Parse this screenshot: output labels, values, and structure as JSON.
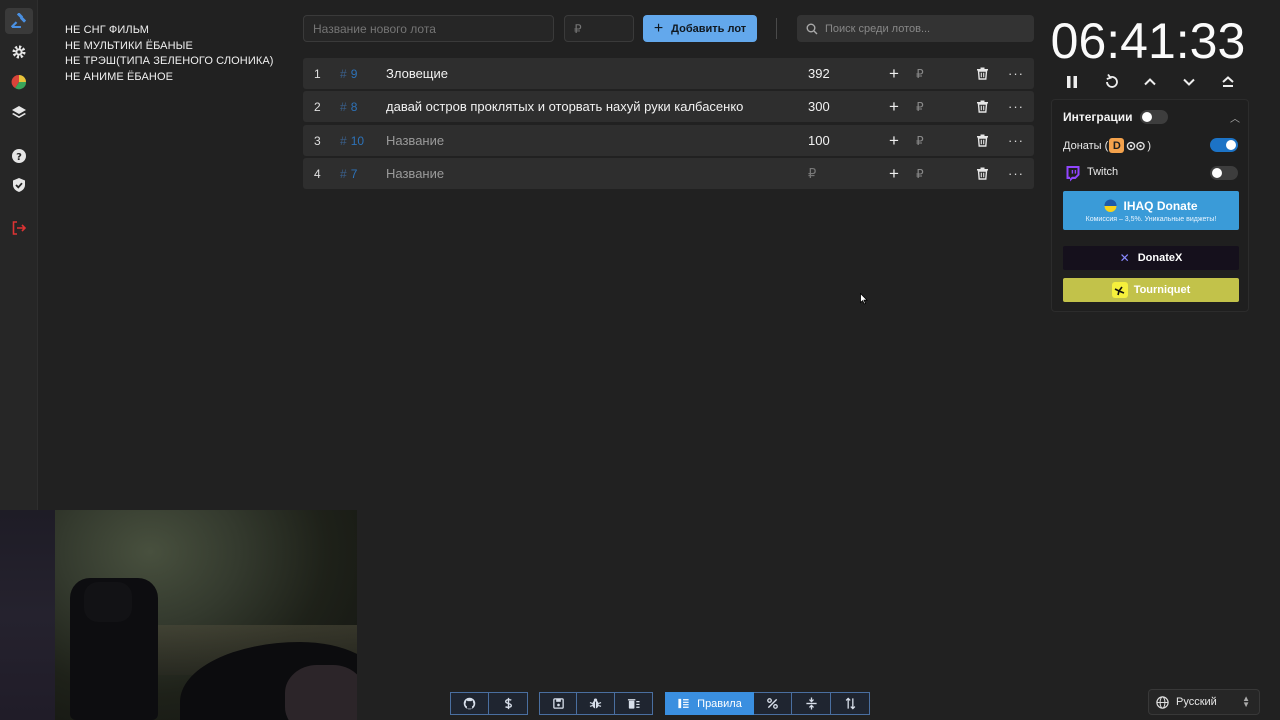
{
  "colors": {
    "accent": "#63a8ec",
    "background": "#212121",
    "row": "#2e2e2e",
    "lot_id": "#2d72b8",
    "ihaq": "#3a9bd8",
    "donatex": "#15101c",
    "tourniquet": "#c2c24a"
  },
  "sidebar": {
    "icons": [
      "gavel-icon",
      "gear-icon",
      "pie-chart-icon",
      "layers-icon",
      "help-icon",
      "shield-check-icon",
      "logout-icon"
    ]
  },
  "rules": [
    "НЕ СНГ ФИЛЬМ",
    "НЕ МУЛЬТИКИ ЁБАНЫЕ",
    "НЕ ТРЭШ(ТИПА ЗЕЛЕНОГО СЛОНИКА)",
    "НЕ АНИМЕ ЁБАНОЕ"
  ],
  "toolbar": {
    "lot_name_placeholder": "Название нового лота",
    "lot_amount_placeholder": "₽",
    "add_label": "Добавить лот",
    "search_placeholder": "Поиск среди лотов..."
  },
  "lots": [
    {
      "index": "1",
      "id": "9",
      "name": "Зловещие",
      "name_placeholder": false,
      "amount": "392",
      "amount_placeholder": false
    },
    {
      "index": "2",
      "id": "8",
      "name": " давай остров проклятых и оторвать нахуй руки калбасенко",
      "name_placeholder": false,
      "amount": "300",
      "amount_placeholder": false
    },
    {
      "index": "3",
      "id": "10",
      "name": "Название",
      "name_placeholder": true,
      "amount": "100",
      "amount_placeholder": false
    },
    {
      "index": "4",
      "id": "7",
      "name": "Название",
      "name_placeholder": true,
      "amount": "₽",
      "amount_placeholder": true
    }
  ],
  "lot_currency": "₽",
  "lot_more": "···",
  "timer": {
    "display": "06:41:33"
  },
  "integrations": {
    "title": "Интеграции",
    "enabled": false,
    "donations_label": "Донаты (",
    "donations_close": ")",
    "donations_logo_letter": "D",
    "donations_enabled": true,
    "twitch_label": "Twitch",
    "twitch_enabled": false,
    "ihaq_label": "IHAQ Donate",
    "ihaq_sub": "Комиссия – 3,5%. Уникальные виджеты!",
    "donatex_label": "DonateX",
    "donatex_mark": "✕",
    "tourniquet_label": "Tourniquet"
  },
  "bottom_bar": {
    "rules_label": "Правила",
    "groups": [
      [
        "github-icon",
        "dollar-icon"
      ],
      [
        "save-icon",
        "bug-icon",
        "trash-list-icon"
      ],
      [
        "rules-icon",
        "percent-icon",
        "split-icon",
        "sort-icon"
      ]
    ]
  },
  "language": {
    "selected": "Русский"
  }
}
